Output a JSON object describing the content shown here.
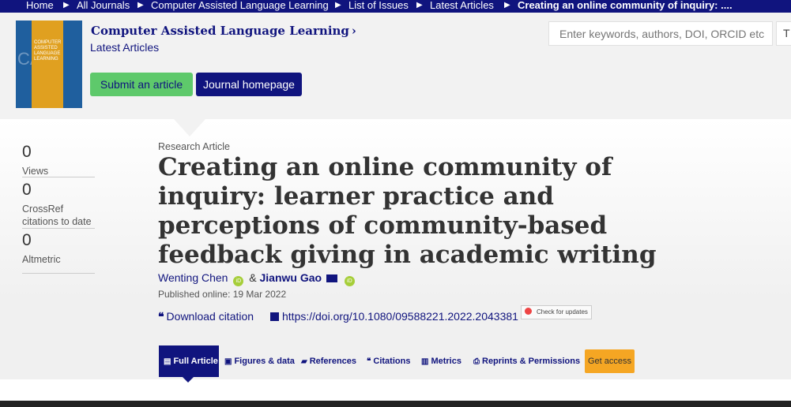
{
  "breadcrumb": [
    "Home",
    "All Journals",
    "Computer Assisted Language Learning",
    "List of Issues",
    "Latest Articles",
    "Creating an online community of inquiry: ...."
  ],
  "journal": {
    "cover_text": "COMPUTER ASSISTED LANGUAGE LEARNING",
    "cover_big": "CALL",
    "title": "Computer Assisted Language Learning",
    "subtitle": "Latest Articles",
    "submit_label": "Submit an article",
    "home_label": "Journal homepage"
  },
  "search": {
    "placeholder": "Enter keywords, authors, DOI, ORCID etc",
    "second": "T"
  },
  "metrics": [
    {
      "value": "0",
      "label": "Views"
    },
    {
      "value": "0",
      "label": "CrossRef citations to date"
    },
    {
      "value": "0",
      "label": "Altmetric"
    }
  ],
  "article": {
    "type": "Research Article",
    "title": "Creating an online community of inquiry: learner practice and perceptions of community-based feedback giving in academic writing",
    "author1": "Wenting Chen",
    "amp": "&",
    "author2": "Jianwu Gao",
    "orcid": "iD",
    "published": "Published online: 19 Mar 2022",
    "download_citation": "Download citation",
    "doi": "https://doi.org/10.1080/09588221.2022.2043381",
    "check_updates": "Check for updates"
  },
  "tabs": [
    "Full Article",
    "Figures & data",
    "References",
    "Citations",
    "Metrics",
    "Reprints & Permissions"
  ],
  "get_access": "Get access",
  "icons": [
    "chevron-right-icon",
    "orcid-icon",
    "mail-icon",
    "quote-icon",
    "external-link-icon",
    "document-icon",
    "image-icon",
    "book-icon",
    "chart-icon",
    "print-icon"
  ]
}
